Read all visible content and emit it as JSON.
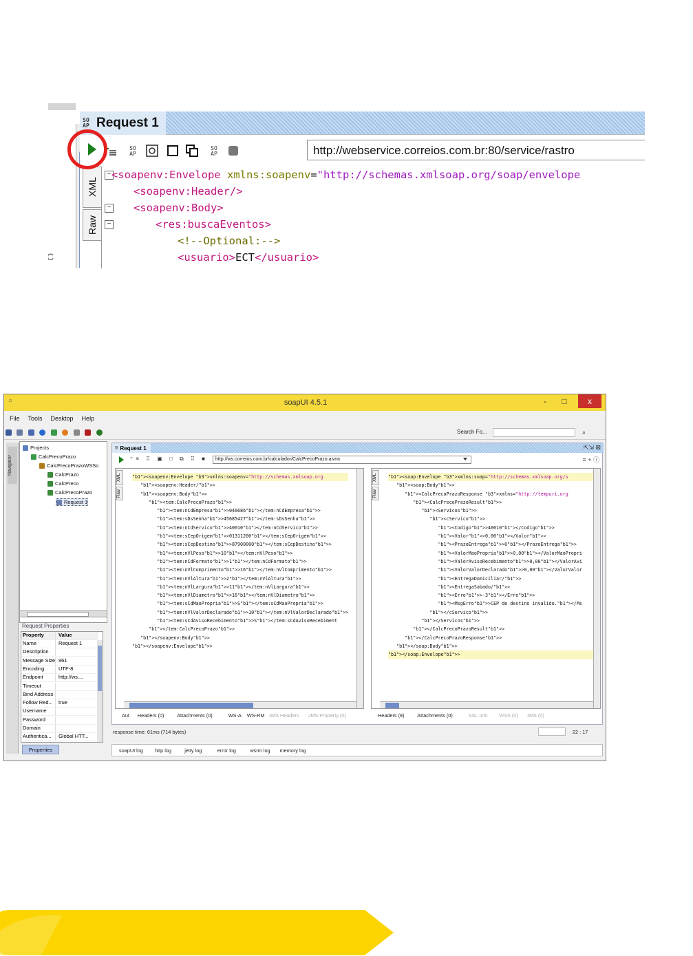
{
  "top_crop": {
    "tab_title": "Request 1",
    "url": "http://webservice.correios.com.br:80/service/rastro",
    "side_tabs": [
      "XML",
      "Raw"
    ],
    "left_fragment": "C",
    "code_lines": [
      {
        "indent": 0,
        "parts": [
          [
            "tg",
            "<soapenv:Envelope "
          ],
          [
            "ta",
            "xmlns:soapenv"
          ],
          [
            "tt",
            "="
          ],
          [
            "tv",
            "\"http://schemas.xmlsoap.org/soap/envelope"
          ]
        ]
      },
      {
        "indent": 1,
        "parts": [
          [
            "tg",
            "<soapenv:Header/>"
          ]
        ]
      },
      {
        "indent": 1,
        "parts": [
          [
            "tg",
            "<soapenv:Body>"
          ]
        ]
      },
      {
        "indent": 2,
        "parts": [
          [
            "tg",
            "<res:buscaEventos>"
          ]
        ]
      },
      {
        "indent": 3,
        "parts": [
          [
            "tc",
            "<!--Optional:-->"
          ]
        ]
      },
      {
        "indent": 3,
        "parts": [
          [
            "tg",
            "<usuario>"
          ],
          [
            "tt",
            "ECT"
          ],
          [
            "tg",
            "</usuario>"
          ]
        ]
      }
    ]
  },
  "window": {
    "title": "soapUI 4.5.1",
    "controls": {
      "minimize": "-",
      "maximize": "□",
      "close": "x"
    },
    "menu": [
      "File",
      "Tools",
      "Desktop",
      "Help"
    ],
    "search_label": "Search Fo...",
    "navigator_label": "Navigator",
    "tree": [
      {
        "label": "Projects",
        "level": 0,
        "color": "#5a7fbf"
      },
      {
        "label": "CalcPrecoPrazo",
        "level": 1,
        "color": "#3a9a4a"
      },
      {
        "label": "CalcPrecoPrazoWSSo",
        "level": 2,
        "color": "#b07a1a"
      },
      {
        "label": "CalcPrazo",
        "level": 3,
        "color": "#3a8a3a"
      },
      {
        "label": "CalcPreco",
        "level": 3,
        "color": "#3a8a3a"
      },
      {
        "label": "CalcPrecoPrazo",
        "level": 3,
        "color": "#3a8a3a"
      },
      {
        "label": "Request 1",
        "level": 4,
        "color": "#6a7fb0",
        "selected": true
      }
    ],
    "props_title": "Request Properties",
    "props_header": [
      "Property",
      "Value"
    ],
    "props": [
      [
        "Name",
        "Request 1"
      ],
      [
        "Description",
        ""
      ],
      [
        "Message Size",
        "961"
      ],
      [
        "Encoding",
        "UTF-8"
      ],
      [
        "Endpoint",
        "http://ws...."
      ],
      [
        "Timeout",
        ""
      ],
      [
        "Bind Address",
        ""
      ],
      [
        "Follow Red...",
        "true"
      ],
      [
        "Username",
        ""
      ],
      [
        "Password",
        ""
      ],
      [
        "Domain",
        ""
      ],
      [
        "Authentica...",
        "Global HTT..."
      ]
    ],
    "props_button": "Properties",
    "request_tab": "Request 1",
    "request_url": "http://ws.correios.com.br/calculador/CalcPrecoPrazo.asmx",
    "left_editor": [
      "<soapenv:Envelope xmlns:soapenv=\"http://schemas.xmlsoap.org",
      "   <soapenv:Header/>",
      "   <soapenv:Body>",
      "      <tem:CalcPrecoPrazo>",
      "         <tem:nCdEmpresa>046686</tem:nCdEmpresa>",
      "         <tem:sDsSenha>45685427</tem:sDsSenha>",
      "         <tem:nCdServico>40010</tem:nCdServico>",
      "         <tem:sCepOrigem>01311200</tem:sCepOrigem>",
      "         <tem:sCepDestino>87900000</tem:sCepDestino>",
      "         <tem:nVlPeso>10</tem:nVlPeso>",
      "         <tem:nCdFormato>1</tem:nCdFormato>",
      "         <tem:nVlComprimento>16</tem:nVlComprimento>",
      "         <tem:nVlAltura>2</tem:nVlAltura>",
      "         <tem:nVlLargura>11</tem:nVlLargura>",
      "         <tem:nVlDiametro>16</tem:nVlDiametro>",
      "         <tem:sCdMaoPropria>S</tem:sCdMaoPropria>",
      "         <tem:nVlValorDeclarado>10</tem:nVlValorDeclarado>",
      "         <tem:sCdAvisoRecebimento>S</tem:sCdAvisoRecebiment",
      "      </tem:CalcPrecoPrazo>",
      "   </soapenv:Body>",
      "</soapenv:Envelope>"
    ],
    "right_editor": [
      "<soap:Envelope xmlns:soap=\"http://schemas.xmlsoap.org/s",
      "   <soap:Body>",
      "      <CalcPrecoPrazoResponse xmlns=\"http://tempuri.org",
      "         <CalcPrecoPrazoResult>",
      "            <Servicos>",
      "               <cServico>",
      "                  <Codigo>40010</Codigo>",
      "                  <Valor>0,00</Valor>",
      "                  <PrazoEntrega>0</PrazoEntrega>",
      "                  <ValorMaoPropria>0,00</ValorMaoPropri",
      "                  <ValorAvisoRecebimento>0,00</ValorAvi",
      "                  <ValorValorDeclarado>0,00</ValorValor",
      "                  <EntregaDomiciliar/>",
      "                  <EntregaSabado/>",
      "                  <Erro>-3</Erro>",
      "                  <MsgErro>CEP de destino invalido.</Ms",
      "               </cServico>",
      "            </Servicos>",
      "         </CalcPrecoPrazoResult>",
      "      </CalcPrecoPrazoResponse>",
      "   </soap:Body>",
      "</soap:Envelope>"
    ],
    "left_tabs": [
      "Aut",
      "Headers (0)",
      "Attachments (0)",
      "WS-A",
      "WS-RM",
      "JMS Headers",
      "JMS Property (0)"
    ],
    "right_tabs": [
      "Headers (8)",
      "Attachments (0)",
      "SSL Info",
      "WSS (0)",
      "JMS (0)"
    ],
    "status": "response time: 61ms (714 bytes)",
    "cursor_pos": "22 : 17",
    "logs": [
      "soapUI log",
      "http log",
      "jetty log",
      "error log",
      "wsrm log",
      "memory log"
    ]
  },
  "colors": {
    "accent_yellow": "#fcd500",
    "title_yellow": "#f6d93b",
    "red_circle": "#e52020"
  }
}
